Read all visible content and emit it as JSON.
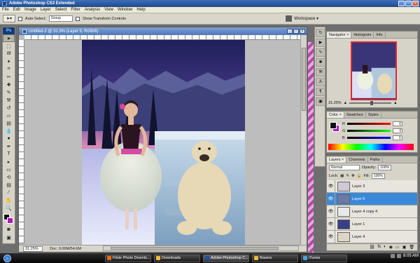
{
  "app": {
    "title": "Adobe Photoshop CS3 Extended",
    "logo": "Ps"
  },
  "window_controls": {
    "minimize": "_",
    "maximize": "□",
    "close": "x"
  },
  "menu": [
    "File",
    "Edit",
    "Image",
    "Layer",
    "Select",
    "Filter",
    "Analysis",
    "View",
    "Window",
    "Help"
  ],
  "options": {
    "auto_select_label": "Auto-Select:",
    "auto_select_value": "Group",
    "show_transform_label": "Show Transform Controls",
    "workspace_label": "Workspace ▾"
  },
  "document": {
    "tab_title": "Untitled-2 @ 31.3% (Layer 5, RGB/8)",
    "zoom": "31.25%",
    "doc_info": "Doc: 9.06M/54.6M"
  },
  "navigator": {
    "tabs": [
      "Navigator ×",
      "Histogram",
      "Info"
    ],
    "zoom": "31.25%"
  },
  "color_panel": {
    "tabs": [
      "Color ×",
      "Swatches",
      "Styles"
    ],
    "channels": [
      {
        "label": "R",
        "value": "0",
        "gradient": "linear-gradient(90deg,#000,#f00)"
      },
      {
        "label": "G",
        "value": "0",
        "gradient": "linear-gradient(90deg,#000,#0f0)"
      },
      {
        "label": "B",
        "value": "0",
        "gradient": "linear-gradient(90deg,#000,#00f)"
      }
    ],
    "foreground": "#111111",
    "background": "#b018b6"
  },
  "layers_panel": {
    "tabs": [
      "Layers ×",
      "Channels",
      "Paths"
    ],
    "blend_mode": "Normal",
    "opacity_label": "Opacity:",
    "opacity": "100%",
    "lock_label": "Lock:",
    "fill_label": "Fill:",
    "fill": "100%",
    "layers": [
      {
        "name": "Layer 3",
        "active": false,
        "thumb": "#cfc8d8"
      },
      {
        "name": "Layer 5",
        "active": true,
        "thumb": "#6a7aa8"
      },
      {
        "name": "Layer 4 copy 4",
        "active": false,
        "thumb": "#e9e9e9"
      },
      {
        "name": "Layer 1",
        "active": false,
        "thumb": "#3a3f85"
      },
      {
        "name": "Layer 4",
        "active": false,
        "thumb": "#ded6c4"
      }
    ],
    "footer_icons": [
      "⛓",
      "fx",
      "◐",
      "◉",
      "▭",
      "▣",
      "🗑"
    ]
  },
  "taskbar": {
    "tasks": [
      {
        "label": "Flickr Photo Downlo...",
        "color": "#e36c0a",
        "active": false
      },
      {
        "label": "Downloads",
        "color": "#f1b73a",
        "active": false
      },
      {
        "label": "Adobe Photoshop C...",
        "color": "#1c4fa0",
        "active": true
      },
      {
        "label": "flowers",
        "color": "#f1b73a",
        "active": false
      },
      {
        "label": "iTunes",
        "color": "#4aa3df",
        "active": false
      }
    ],
    "clock": "8:05 AM"
  }
}
